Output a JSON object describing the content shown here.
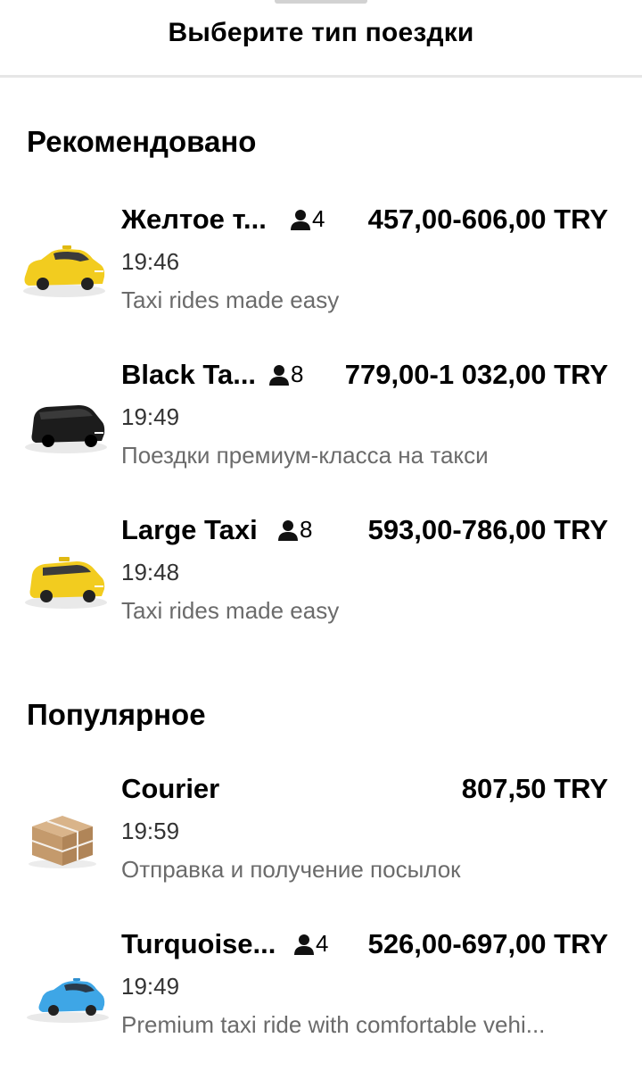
{
  "header": {
    "title": "Выберите тип поездки"
  },
  "sections": [
    {
      "title": "Рекомендовано",
      "rides": [
        {
          "name": "Желтое т...",
          "capacity": "4",
          "price": "457,00-606,00 TRY",
          "eta": "19:46",
          "description": "Taxi rides made easy",
          "icon": "yellow-taxi-icon"
        },
        {
          "name": "Black Ta...",
          "capacity": "8",
          "price": "779,00-1 032,00 TRY",
          "eta": "19:49",
          "description": "Поездки премиум-класса на такси",
          "icon": "black-van-icon"
        },
        {
          "name": "Large Taxi",
          "capacity": "8",
          "price": "593,00-786,00 TRY",
          "eta": "19:48",
          "description": "Taxi rides made easy",
          "icon": "yellow-van-icon"
        }
      ]
    },
    {
      "title": "Популярное",
      "rides": [
        {
          "name": "Courier",
          "capacity": "",
          "price": "807,50 TRY",
          "eta": "19:59",
          "description": "Отправка и получение посылок",
          "icon": "package-box-icon"
        },
        {
          "name": "Turquoise...",
          "capacity": "4",
          "price": "526,00-697,00 TRY",
          "eta": "19:49",
          "description": "Premium taxi ride with comfortable vehi...",
          "icon": "turquoise-taxi-icon"
        }
      ]
    }
  ],
  "colors": {
    "yellow_taxi": "#f2cc1f",
    "black_van": "#1c1c1c",
    "turquoise_taxi": "#3ea6e6",
    "box": "#c49a6c",
    "secondary_text": "#6b6b6b"
  }
}
